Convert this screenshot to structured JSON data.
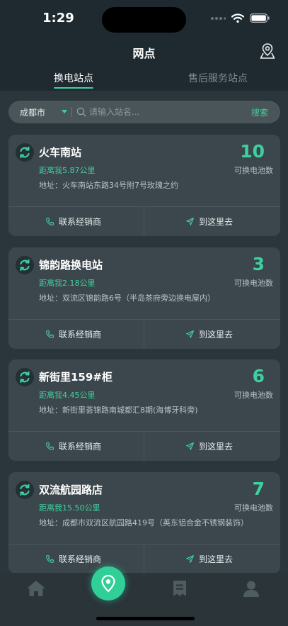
{
  "status": {
    "time": "1:29"
  },
  "nav": {
    "title": "网点"
  },
  "tabs": [
    {
      "label": "换电站点",
      "active": true
    },
    {
      "label": "售后服务站点",
      "active": false
    }
  ],
  "search": {
    "city": "成都市",
    "placeholder": "请输入站名...",
    "value": "",
    "button": "搜索"
  },
  "stations": [
    {
      "name": "火车南站",
      "distance": "距离我5.87公里",
      "address": "地址：火车南站东路34号附7号玫瑰之约",
      "count": "10",
      "count_label": "可换电池数",
      "contact": "联系经销商",
      "navigate": "到这里去"
    },
    {
      "name": "锦韵路换电站",
      "distance": "距离我2.18公里",
      "address": "地址：双流区锦韵路6号（半岛茶府旁边换电屋内）",
      "count": "3",
      "count_label": "可换电池数",
      "contact": "联系经销商",
      "navigate": "到这里去"
    },
    {
      "name": "新街里159#柜",
      "distance": "距离我4.45公里",
      "address": "地址：新街里荟锦路南城都汇8期(海博牙科旁)",
      "count": "6",
      "count_label": "可换电池数",
      "contact": "联系经销商",
      "navigate": "到这里去"
    },
    {
      "name": "双流航园路店",
      "distance": "距离我15.50公里",
      "address": "地址：成都市双流区航园路419号（英东铝合金不锈钢装饰）",
      "count": "7",
      "count_label": "可换电池数",
      "contact": "联系经销商",
      "navigate": "到这里去"
    }
  ],
  "bottom_tabs": [
    "home-icon",
    "location-icon",
    "orders-icon",
    "profile-icon"
  ],
  "colors": {
    "accent": "#3fd0a0",
    "card": "#3b474c",
    "background": "#2b363c"
  }
}
